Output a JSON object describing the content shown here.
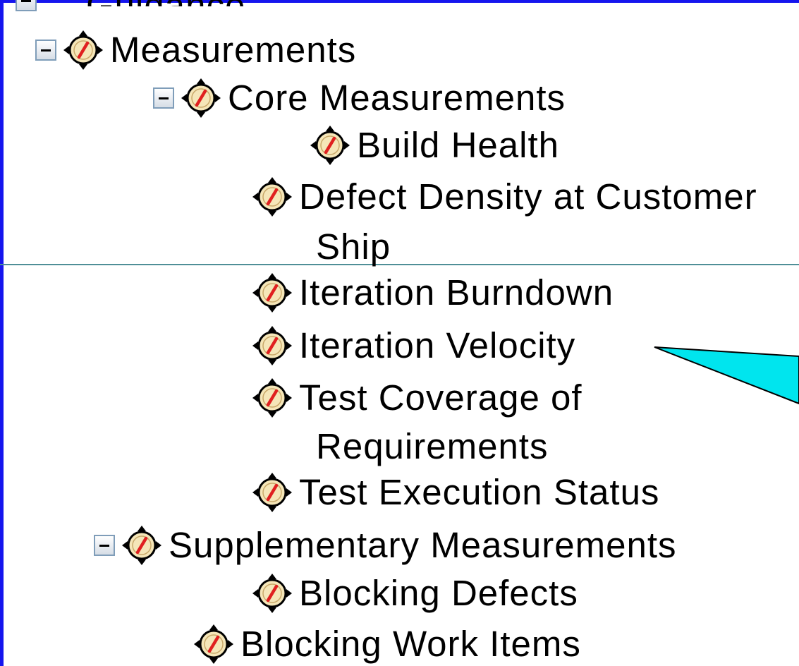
{
  "tree": {
    "partial_top_item": {
      "label": "Guidance"
    },
    "root": {
      "label": "Measurements",
      "expanded": true
    },
    "core": {
      "label": "Core Measurements",
      "expanded": true,
      "items": [
        {
          "label": "Build Health"
        },
        {
          "label_line1": "Defect Density at Customer",
          "label_line2": "Ship"
        },
        {
          "label": "Iteration Burndown"
        },
        {
          "label": "Iteration Velocity"
        },
        {
          "label_line1": "Test Coverage of",
          "label_line2": "Requirements"
        },
        {
          "label": "Test Execution Status"
        }
      ]
    },
    "supplementary": {
      "label": "Supplementary Measurements",
      "expanded": true,
      "items": [
        {
          "label": "Blocking Defects"
        },
        {
          "label": "Blocking Work Items"
        }
      ]
    }
  },
  "icons": {
    "node_icon": "measurement-gauge-icon",
    "toggle_icon": "collapse-minus-icon"
  },
  "colors": {
    "frame_border": "#1515ee",
    "callout_fill": "#00e5ee",
    "icon_fill": "#f5e6b8",
    "icon_slash": "#e02020"
  }
}
